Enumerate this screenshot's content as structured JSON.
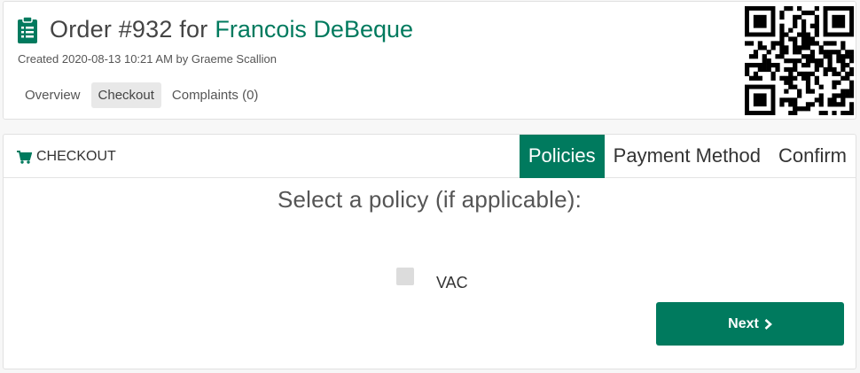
{
  "header": {
    "title_prefix": "Order #932 for",
    "customer_name": "Francois DeBeque",
    "created": "Created 2020-08-13 10:21 AM by Graeme Scallion",
    "icon": "clipboard-icon"
  },
  "tabs": [
    {
      "label": "Overview",
      "active": false
    },
    {
      "label": "Checkout",
      "active": true
    },
    {
      "label": "Complaints (0)",
      "active": false
    }
  ],
  "checkout": {
    "section_label": "CHECKOUT",
    "icon": "cart-icon",
    "steps": [
      {
        "label": "Policies",
        "active": true
      },
      {
        "label": "Payment Method",
        "active": false
      },
      {
        "label": "Confirm",
        "active": false
      }
    ],
    "prompt": "Select a policy (if applicable):",
    "policies": [
      {
        "label": "VAC",
        "checked": false
      }
    ],
    "next_label": "Next",
    "next_icon": "chevron-right-icon"
  },
  "colors": {
    "accent": "#007a5e"
  }
}
